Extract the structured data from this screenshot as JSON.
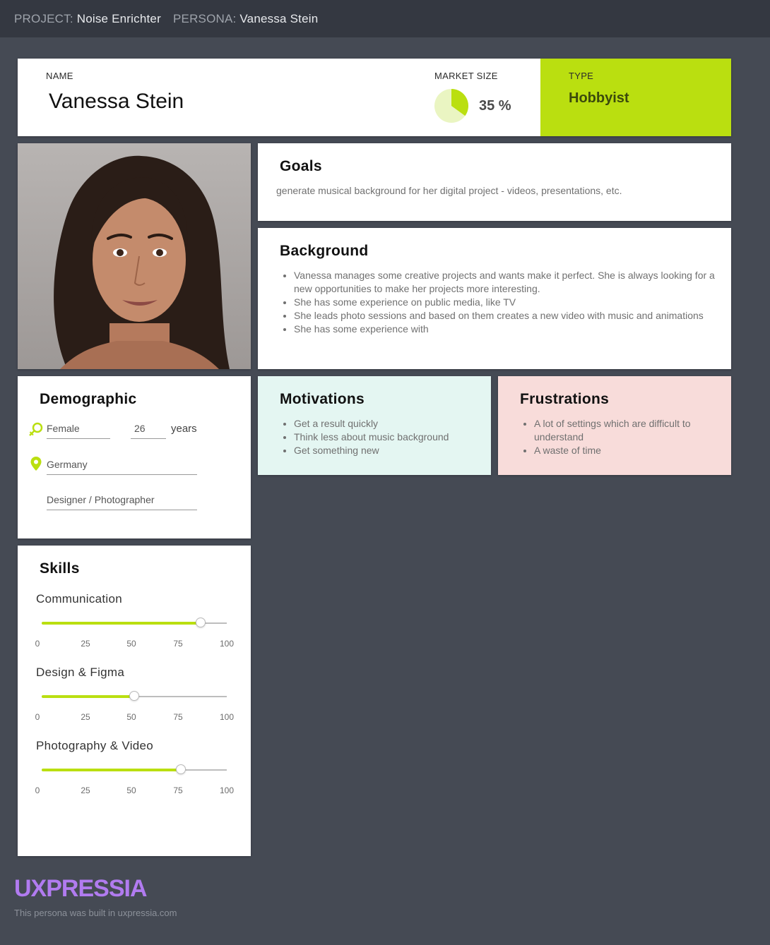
{
  "topbar": {
    "project_label": "PROJECT:",
    "project_name": "Noise Enrichter",
    "persona_label": "PERSONA:",
    "persona_name": "Vanessa Stein"
  },
  "header": {
    "name_label": "NAME",
    "name": "Vanessa Stein",
    "market_label": "MARKET SIZE",
    "market_value": "35 %",
    "market_fraction": 0.35,
    "type_label": "TYPE",
    "type": "Hobbyist"
  },
  "goals": {
    "title": "Goals",
    "text": "generate musical background for her digital project - videos, presentations, etc."
  },
  "background": {
    "title": "Background",
    "items": [
      "Vanessa  manages some creative projects and wants make it perfect. She is always looking for a new opportunities to make her projects more interesting.",
      "She has some experience on public media,  like TV",
      "She leads photo sessions and based on them creates a new video with music and animations",
      "She has some experience with"
    ]
  },
  "demographic": {
    "title": "Demographic",
    "gender": "Female",
    "age": "26",
    "age_unit": "years",
    "location": "Germany",
    "occupation": "Designer / Photographer"
  },
  "motivations": {
    "title": "Motivations",
    "items": [
      "Get a result quickly",
      "Think less about music background",
      "Get something new"
    ]
  },
  "frustrations": {
    "title": "Frustrations",
    "items": [
      "A lot of settings which are difficult to understand",
      "A waste of time"
    ]
  },
  "skills": {
    "title": "Skills",
    "ticks": [
      "0",
      "25",
      "50",
      "75",
      "100"
    ],
    "items": [
      {
        "label": "Communication",
        "value": 86
      },
      {
        "label": "Design & Figma",
        "value": 50
      },
      {
        "label": "Photography & Video",
        "value": 75
      }
    ]
  },
  "colors": {
    "accent": "#badf10",
    "motivations_bg": "#e4f6f2",
    "frustrations_bg": "#f8dcda",
    "logo": "#b17bf0"
  },
  "footer": {
    "logo": "UXPRESSIA",
    "text": "This persona was built in uxpressia.com"
  }
}
